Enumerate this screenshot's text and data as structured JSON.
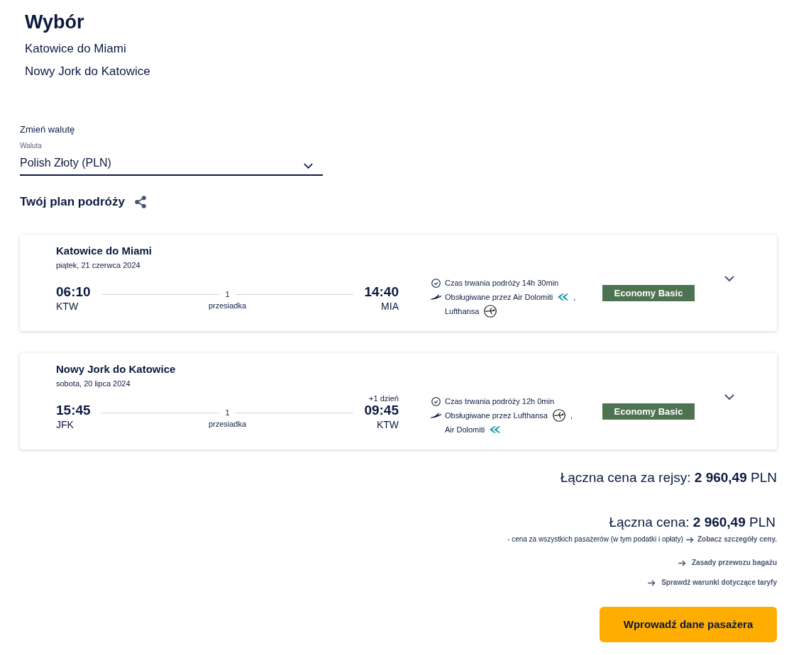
{
  "header": {
    "title": "Wybór",
    "routes": [
      "Katowice do Miami",
      "Nowy Jork do Katowice"
    ]
  },
  "currency": {
    "heading": "Zmień walutę",
    "label": "Waluta",
    "value": "Polish Złoty (PLN)"
  },
  "itinerary": {
    "title": "Twój plan podróży"
  },
  "flights": [
    {
      "route": "Katowice do Miami",
      "date": "piątek, 21 czerwca 2024",
      "departure": {
        "time": "06:10",
        "airport": "KTW"
      },
      "stops": {
        "count": "1",
        "label": "przesiadka"
      },
      "arrival": {
        "time": "14:40",
        "airport": "MIA"
      },
      "duration": "Czas trwania podróży 14h 30min",
      "operators": [
        {
          "text": "Obsługiwane przez Air Dolomiti",
          "kind": "dolomiti",
          "separator": ","
        },
        {
          "text": "Lufthansa",
          "kind": "crane"
        }
      ],
      "fare": "Economy Basic",
      "expanded": false
    },
    {
      "route": "Nowy Jork do Katowice",
      "date": "sobota, 20 lipca 2024",
      "departure": {
        "time": "15:45",
        "airport": "JFK"
      },
      "stops": {
        "count": "1",
        "label": "przesiadka"
      },
      "arrival": {
        "day_note": "+1 dzień",
        "time": "09:45",
        "airport": "KTW"
      },
      "duration": "Czas trwania podróży 12h 0min",
      "operators": [
        {
          "text": "Obsługiwane przez Lufthansa",
          "kind": "crane",
          "separator": ","
        },
        {
          "text": "Air Dolomiti",
          "kind": "dolomiti"
        }
      ],
      "fare": "Economy Basic",
      "expanded": false
    }
  ],
  "price": {
    "flights_total": "Łączna cena za rejsy: **2 960,49** PLN",
    "total": "Łączna cena: **2 960,49** PLN",
    "note": "- cena za wszystkich pasażerów (w tym podatki i opłaty)",
    "details_link": "Zobacz szczegóły ceny."
  },
  "links": [
    "Zasady przewozu bagażu",
    "Sprawdź warunki dotyczące taryfy"
  ],
  "cta": "Wprowadź dane pasażera"
}
